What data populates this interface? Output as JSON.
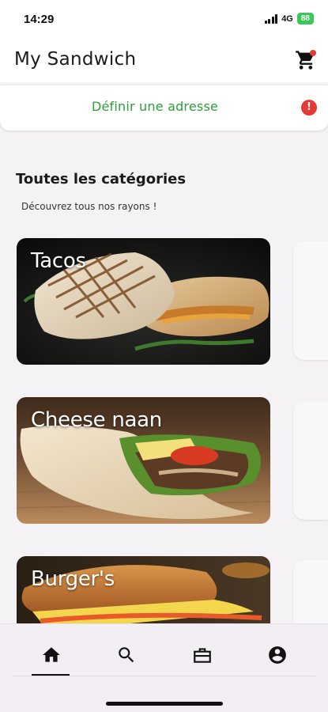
{
  "status_bar": {
    "time": "14:29",
    "network": "4G",
    "battery": "88"
  },
  "app_bar": {
    "title": "My Sandwich",
    "cart_icon": "shopping-cart-icon"
  },
  "address": {
    "label": "Définir une adresse",
    "alert_icon": "alert-icon",
    "alert_glyph": "!"
  },
  "categories_section": {
    "title": "Toutes les catégories",
    "subtitle": "Découvrez tous nos rayons !",
    "items": [
      {
        "label": "Tacos"
      },
      {
        "label": "Cheese naan"
      },
      {
        "label": "Burger's"
      }
    ]
  },
  "bottom_nav": {
    "items": [
      {
        "icon": "home-icon",
        "active": true
      },
      {
        "icon": "search-icon",
        "active": false
      },
      {
        "icon": "briefcase-icon",
        "active": false
      },
      {
        "icon": "account-icon",
        "active": false
      }
    ]
  },
  "colors": {
    "accent_green": "#2e9e3a",
    "alert_red": "#e53935",
    "nav_background": "#f2eef3"
  }
}
